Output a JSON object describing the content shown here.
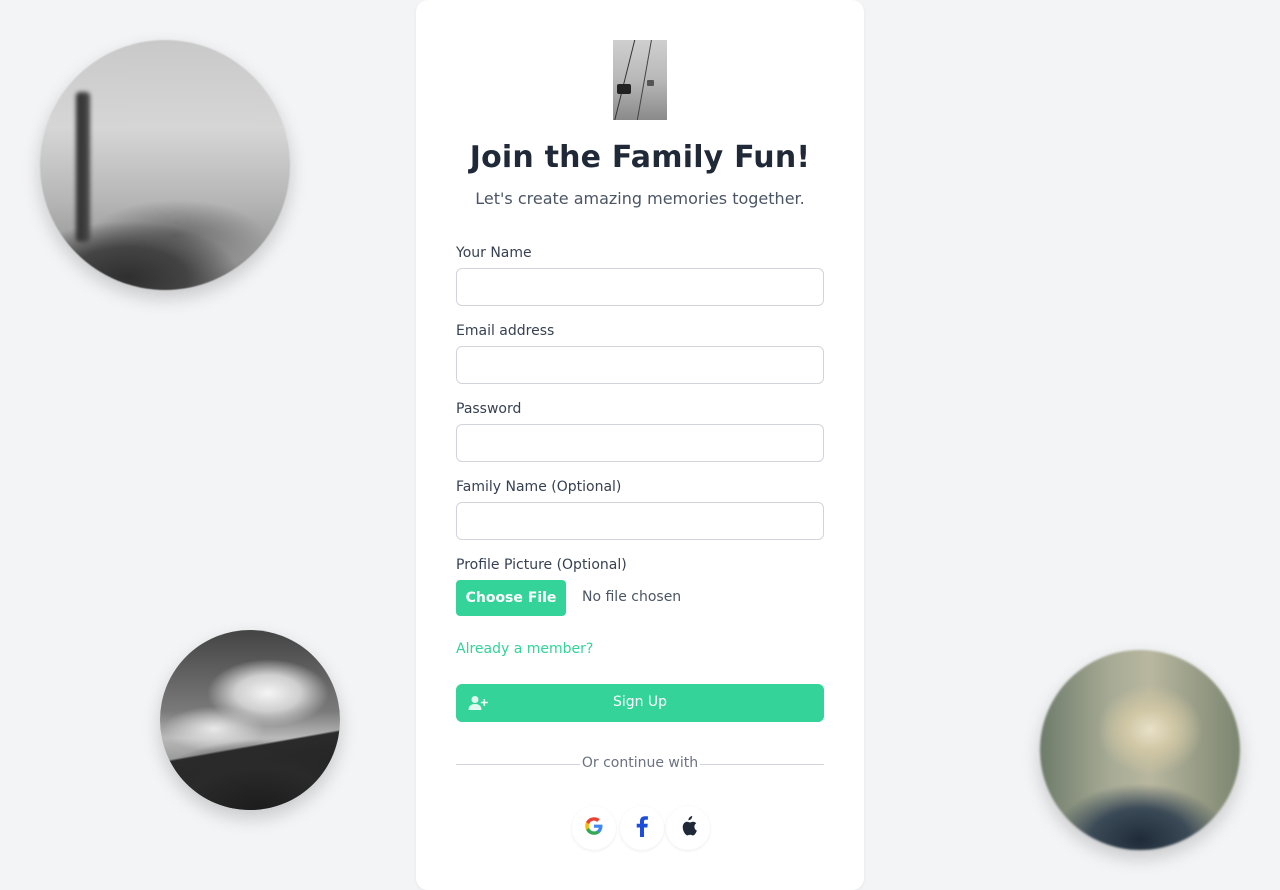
{
  "signup": {
    "title": "Join the Family Fun!",
    "subtitle": "Let's create amazing memories together.",
    "fields": {
      "name": {
        "label": "Your Name",
        "value": "",
        "placeholder": ""
      },
      "email": {
        "label": "Email address",
        "value": "",
        "placeholder": ""
      },
      "password": {
        "label": "Password",
        "value": "",
        "placeholder": ""
      },
      "family_name": {
        "label": "Family Name (Optional)",
        "value": "",
        "placeholder": ""
      }
    },
    "profile_picture": {
      "label": "Profile Picture (Optional)",
      "choose_button": "Choose File",
      "status": "No file chosen"
    },
    "member_link": "Already a member?",
    "submit": {
      "label": "Sign Up",
      "icon": "user-plus-icon"
    },
    "divider": "Or continue with",
    "social": [
      {
        "name": "google",
        "icon": "google-icon",
        "color": "#4285F4"
      },
      {
        "name": "facebook",
        "icon": "facebook-icon",
        "color": "#1D4ED8"
      },
      {
        "name": "apple",
        "icon": "apple-icon",
        "color": "#1F2937"
      }
    ]
  },
  "theme": {
    "accent": "#34D399",
    "background": "#F3F4F6",
    "card": "#FFFFFF",
    "heading": "#1F2937",
    "text": "#4B5563"
  }
}
